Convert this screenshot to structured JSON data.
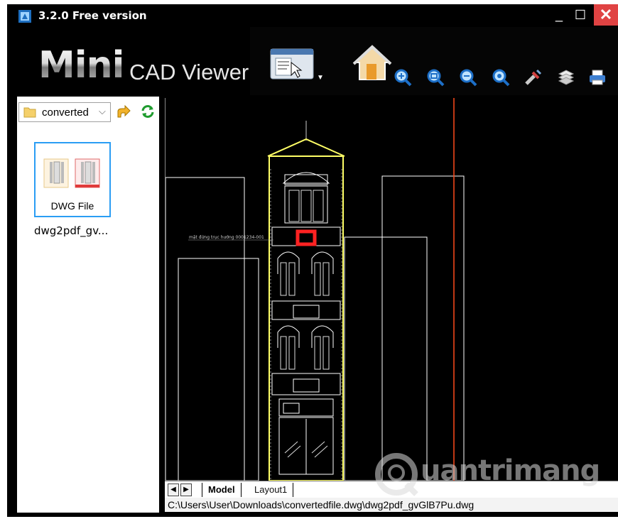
{
  "window": {
    "title": "3.2.0 Free version",
    "controls": {
      "minimize": "_",
      "maximize": "☐",
      "close": "✕"
    }
  },
  "logo": {
    "mini": "Mini",
    "sub": "CAD Viewer"
  },
  "toolbar": {
    "tools": [
      "layout-icon",
      "home-icon",
      "zoom-in-icon",
      "zoom-window-icon",
      "zoom-out-icon",
      "zoom-extents-icon",
      "pan-icon",
      "layers-icon",
      "print-icon"
    ]
  },
  "sidebar": {
    "folder": "converted",
    "files": [
      {
        "type": "DWG File",
        "name": "dwg2pdf_gv..."
      }
    ]
  },
  "tabs": {
    "model": "Model",
    "layout": "Layout1"
  },
  "status": {
    "path": "C:\\Users\\User\\Downloads\\convertedfile.dwg\\dwg2pdf_gvGlB7Pu.dwg"
  },
  "drawing": {
    "annotation": "mặt đứng trục hướng 0001234-001"
  },
  "watermark": {
    "text": "uantrimang"
  },
  "colors": {
    "background": "#000000",
    "title_close": "#e04343",
    "drawing_frame": "#ffff66",
    "accent_red": "#ff3333",
    "selection": "#2a9df4"
  }
}
